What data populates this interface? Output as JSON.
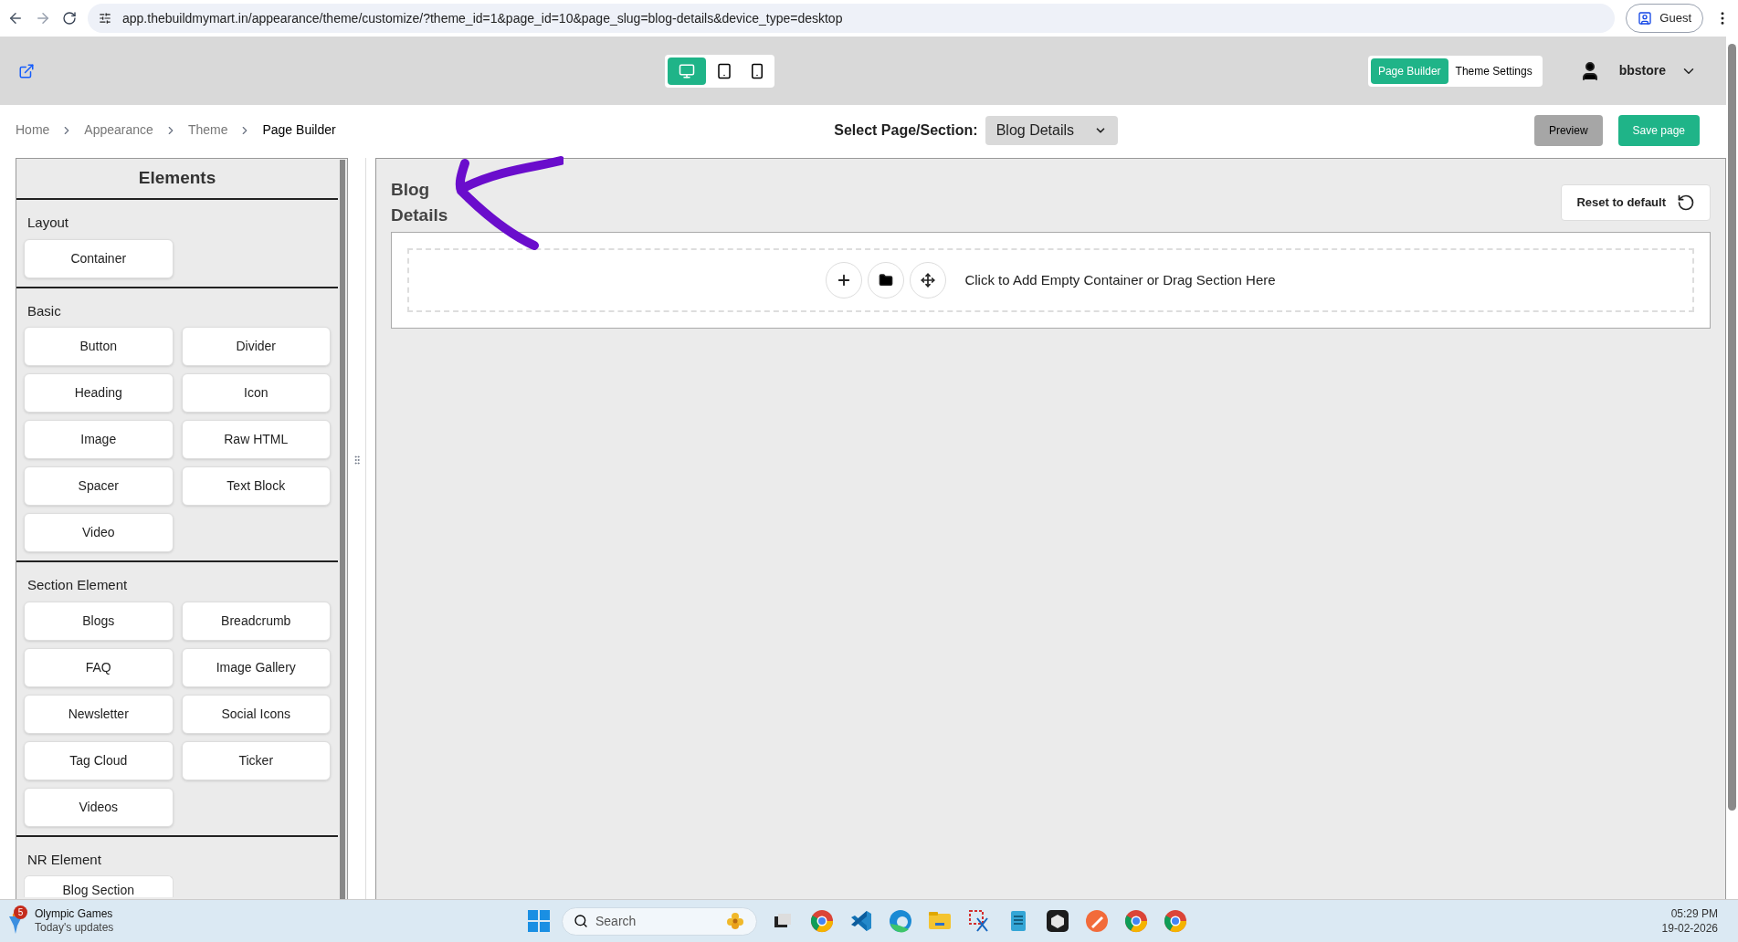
{
  "browser": {
    "url": "app.thebuildmymart.in/appearance/theme/customize/?theme_id=1&page_id=10&page_slug=blog-details&device_type=desktop",
    "profile": "Guest"
  },
  "header": {
    "devices": [
      {
        "kind": "desktop",
        "selected": true
      },
      {
        "kind": "tablet",
        "selected": false
      },
      {
        "kind": "mobile",
        "selected": false
      }
    ],
    "tabs": [
      {
        "label": "Page Builder",
        "selected": true
      },
      {
        "label": "Theme Settings",
        "selected": false
      }
    ],
    "user": "bbstore"
  },
  "breadcrumb": [
    "Home",
    "Appearance",
    "Theme",
    "Page Builder"
  ],
  "page_select": {
    "label": "Select Page/Section:",
    "value": "Blog Details"
  },
  "actions": {
    "preview": "Preview",
    "save": "Save page"
  },
  "sidebar": {
    "title": "Elements",
    "sections": [
      {
        "title": "Layout",
        "items": [
          "Container"
        ]
      },
      {
        "title": "Basic",
        "items": [
          "Button",
          "Divider",
          "Heading",
          "Icon",
          "Image",
          "Raw HTML",
          "Spacer",
          "Text Block",
          "Video"
        ]
      },
      {
        "title": "Section Element",
        "items": [
          "Blogs",
          "Breadcrumb",
          "FAQ",
          "Image Gallery",
          "Newsletter",
          "Social Icons",
          "Tag Cloud",
          "Ticker",
          "Videos"
        ]
      },
      {
        "title": "NR Element",
        "items": [
          "Blog Section"
        ]
      }
    ]
  },
  "canvas": {
    "title": "Blog Details",
    "reset": "Reset to default",
    "drop_text": "Click to Add Empty Container or Drag Section Here"
  },
  "taskbar": {
    "widget_title": "Olympic Games",
    "widget_subtitle": "Today's updates",
    "badge": "5",
    "search": "Search",
    "time": "05:29 PM",
    "date": "19-02-2026"
  }
}
